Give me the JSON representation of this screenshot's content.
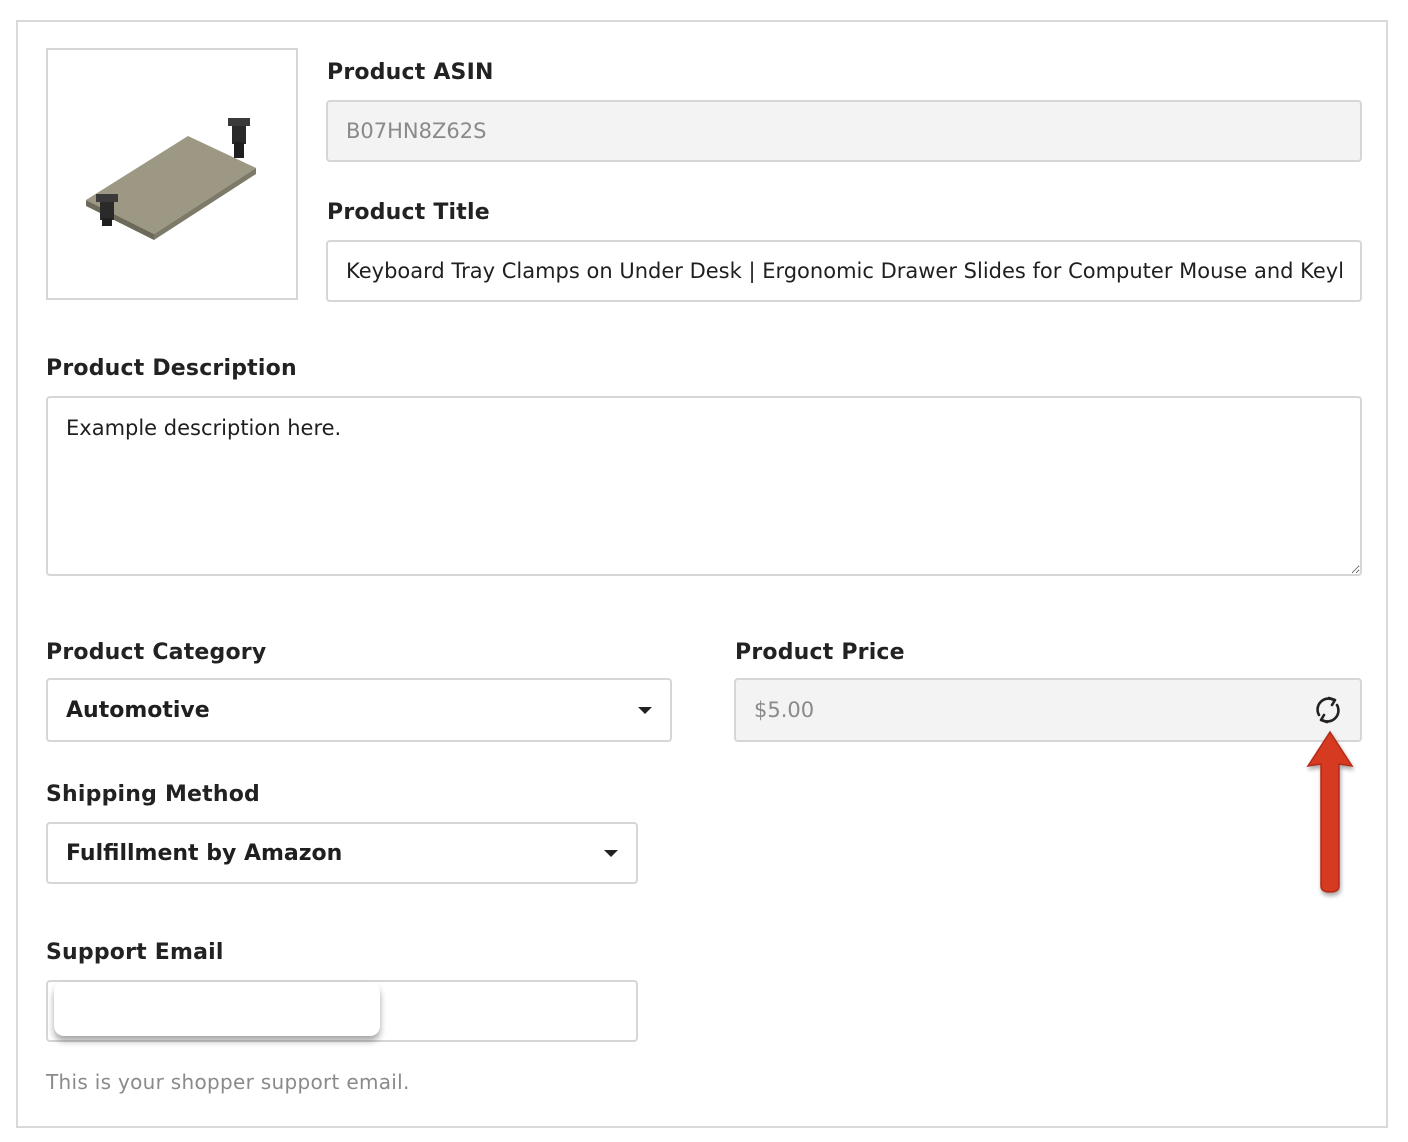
{
  "product": {
    "asin_label": "Product ASIN",
    "asin_value": "B07HN8Z62S",
    "title_label": "Product Title",
    "title_value": "Keyboard Tray Clamps on Under Desk | Ergonomic Drawer Slides for Computer Mouse and Keyboard",
    "description_label": "Product Description",
    "description_value": "Example description here.",
    "category_label": "Product Category",
    "category_value": "Automotive",
    "price_label": "Product Price",
    "price_value": "$5.00",
    "shipping_label": "Shipping Method",
    "shipping_value": "Fulfillment by Amazon",
    "support_email_label": "Support Email",
    "support_email_value": "",
    "support_email_help": "This is your shopper support email."
  },
  "icons": {
    "refresh": "refresh-icon",
    "dropdown": "chevron-down-icon",
    "annotation": "red-arrow-icon"
  },
  "colors": {
    "annotation_arrow": "#d63b22",
    "readonly_bg": "#f3f3f3",
    "border": "#d6d6d6"
  }
}
